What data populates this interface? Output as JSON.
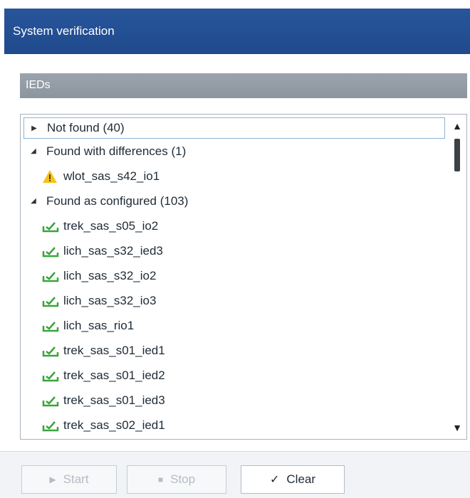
{
  "window": {
    "title": "System verification"
  },
  "section": {
    "label": "IEDs"
  },
  "tree": {
    "groups": [
      {
        "label": "Not found (40)",
        "expander": "▶",
        "expanded": false,
        "items": []
      },
      {
        "label": "Found with differences (1)",
        "expander": "◢",
        "expanded": true,
        "items": [
          {
            "label": "wlot_sas_s42_io1",
            "icon": "warning-icon"
          }
        ]
      },
      {
        "label": "Found as configured (103)",
        "expander": "◢",
        "expanded": true,
        "items": [
          {
            "label": "trek_sas_s05_io2",
            "icon": "check-device-icon"
          },
          {
            "label": "lich_sas_s32_ied3",
            "icon": "check-device-icon"
          },
          {
            "label": "lich_sas_s32_io2",
            "icon": "check-device-icon"
          },
          {
            "label": "lich_sas_s32_io3",
            "icon": "check-device-icon"
          },
          {
            "label": "lich_sas_rio1",
            "icon": "check-device-icon"
          },
          {
            "label": "trek_sas_s01_ied1",
            "icon": "check-device-icon"
          },
          {
            "label": "trek_sas_s01_ied2",
            "icon": "check-device-icon"
          },
          {
            "label": "trek_sas_s01_ied3",
            "icon": "check-device-icon"
          },
          {
            "label": "trek_sas_s02_ied1",
            "icon": "check-device-icon"
          }
        ]
      }
    ]
  },
  "buttons": {
    "start": {
      "label": "Start",
      "enabled": false
    },
    "stop": {
      "label": "Stop",
      "enabled": false
    },
    "clear": {
      "label": "Clear",
      "enabled": true
    }
  },
  "colors": {
    "titlebar": "#1f4a8c",
    "section_header": "#8c959f",
    "warning": "#f4c21a",
    "success": "#3aa53a"
  }
}
